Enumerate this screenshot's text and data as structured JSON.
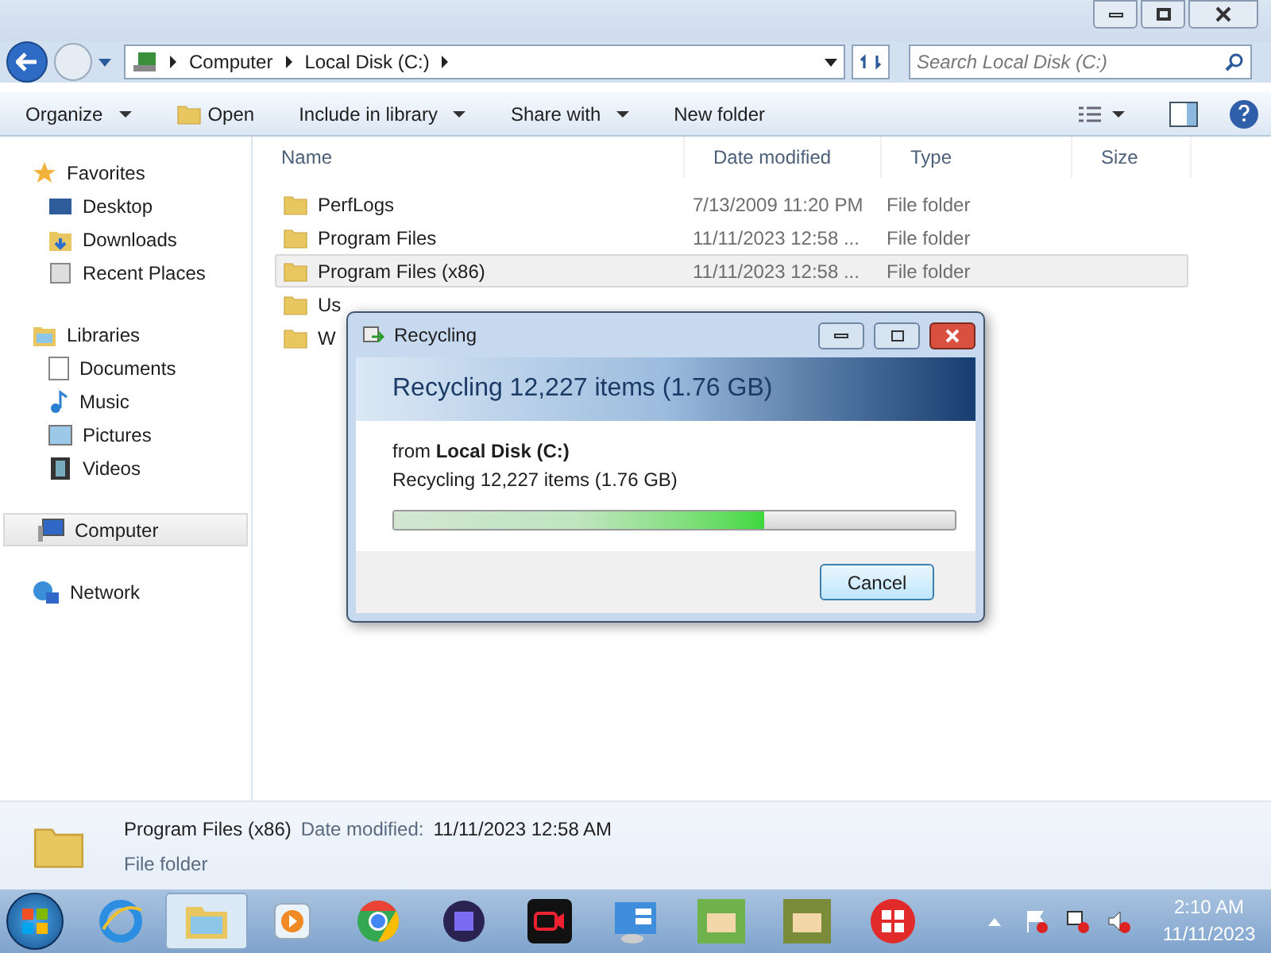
{
  "address_bar": {
    "crumbs": [
      "Computer",
      "Local Disk (C:)"
    ]
  },
  "search": {
    "placeholder": "Search Local Disk (C:)"
  },
  "toolbar": [
    {
      "label": "Organize",
      "dropdown": true,
      "kind": "menu"
    },
    {
      "label": "Open",
      "dropdown": false,
      "kind": "open"
    },
    {
      "label": "Include in library",
      "dropdown": true,
      "kind": "menu"
    },
    {
      "label": "Share with",
      "dropdown": true,
      "kind": "menu"
    },
    {
      "label": "New folder",
      "dropdown": false,
      "kind": "menu"
    }
  ],
  "sidebar": {
    "groups": [
      {
        "label": "Favorites",
        "kind": "favorites",
        "selected": false,
        "children": [
          {
            "label": "Desktop",
            "kind": "desktop"
          },
          {
            "label": "Downloads",
            "kind": "downloads"
          },
          {
            "label": "Recent Places",
            "kind": "recent"
          }
        ]
      },
      {
        "label": "Libraries",
        "kind": "libraries",
        "selected": false,
        "children": [
          {
            "label": "Documents",
            "kind": "documents"
          },
          {
            "label": "Music",
            "kind": "music"
          },
          {
            "label": "Pictures",
            "kind": "pictures"
          },
          {
            "label": "Videos",
            "kind": "videos"
          }
        ]
      },
      {
        "label": "Computer",
        "kind": "computer",
        "selected": true
      },
      {
        "label": "Network",
        "kind": "network",
        "selected": false
      }
    ]
  },
  "table": {
    "columns": [
      "Name",
      "Date modified",
      "Type",
      "Size"
    ],
    "rows": [
      {
        "name": "PerfLogs",
        "date": "7/13/2009 11:20 PM",
        "type": "File folder",
        "selected": false
      },
      {
        "name": "Program Files",
        "date": "11/11/2023 12:58 ...",
        "type": "File folder",
        "selected": false
      },
      {
        "name": "Program Files (x86)",
        "date": "11/11/2023 12:58 ...",
        "type": "File folder",
        "selected": true
      },
      {
        "name": "Us",
        "selected": false
      },
      {
        "name": "W",
        "selected": false
      }
    ]
  },
  "dialog": {
    "title": "Recycling",
    "heading": "Recycling 12,227 items (1.76 GB)",
    "source": "from **Local Disk (C:)**",
    "detail": "Recycling 12,227 items (1.76 GB)",
    "button": "Cancel",
    "level": 0.66
  },
  "details_pane": {
    "name": "Program Files (x86)",
    "date_label": "Date modified:",
    "date": "11/11/2023 12:58 AM",
    "type": "File folder"
  },
  "taskbar": {
    "apps": [
      {
        "kind": "ie",
        "selected": false
      },
      {
        "kind": "explorer",
        "selected": true
      },
      {
        "kind": "media",
        "selected": false
      },
      {
        "kind": "chrome",
        "selected": false
      },
      {
        "kind": "app",
        "selected": false
      },
      {
        "kind": "recorder",
        "selected": false
      },
      {
        "kind": "panel",
        "selected": false
      },
      {
        "kind": "game",
        "selected": false
      },
      {
        "kind": "game2",
        "selected": false
      },
      {
        "kind": "windows",
        "selected": false
      }
    ],
    "time": "2:10 AM",
    "date": "11/11/2023"
  }
}
